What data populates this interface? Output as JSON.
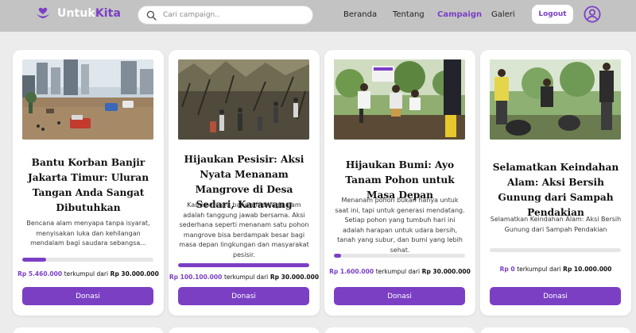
{
  "brand": {
    "name_part1": "Untuk",
    "name_part2": "Kita",
    "logo_icon": "heart-hands-icon",
    "accent": "#7b3fc4"
  },
  "search": {
    "placeholder": "Cari campaign..",
    "icon": "search-icon"
  },
  "nav": [
    {
      "label": "Beranda",
      "active": false
    },
    {
      "label": "Tentang",
      "active": false
    },
    {
      "label": "Campaign",
      "active": true
    },
    {
      "label": "Galeri",
      "active": false
    }
  ],
  "header": {
    "logout_label": "Logout",
    "avatar_icon": "user-circle-icon"
  },
  "campaigns": [
    {
      "title": "Bantu Korban Banjir Jakarta Timur: Uluran Tangan Anda Sangat Dibutuhkan",
      "description": "Bencana alam menyapa tanpa isyarat, menyisakan luka dan kehilangan mendalam bagi saudara sebangsa...",
      "collected": "Rp 5.460.000",
      "collected_label": "terkumpul dari",
      "target": "Rp 30.000.000",
      "progress": 0.182,
      "donate_label": "Donasi",
      "image": "flooded-city-street-photo"
    },
    {
      "title": "Hijaukan Pesisir: Aksi Nyata Menanam Mangrove di Desa Sedari, Karawang",
      "description": "Kami percaya bahwa menjaga alam adalah tanggung jawab bersama. Aksi sederhana seperti menanam satu pohon mangrove bisa berdampak besar bagi masa depan lingkungan dan masyarakat pesisir.",
      "collected": "Rp 100.100.000",
      "collected_label": "terkumpul dari",
      "target": "Rp 30.000.000",
      "progress": 1.0,
      "donate_label": "Donasi",
      "image": "mangrove-planting-photo"
    },
    {
      "title": "Hijaukan Bumi: Ayo Tanam Pohon untuk Masa Depan",
      "description": "Menanam pohon bukan hanya untuk saat ini, tapi untuk generasi mendatang. Setiap pohon yang tumbuh hari ini adalah harapan untuk udara bersih, tanah yang subur, dan bumi yang lebih sehat.",
      "collected": "Rp 1.600.000",
      "collected_label": "terkumpul dari",
      "target": "Rp 30.000.000",
      "progress": 0.053,
      "donate_label": "Donasi",
      "image": "tree-planting-volunteers-photo"
    },
    {
      "title": "Selamatkan Keindahan Alam: Aksi Bersih Gunung dari Sampah Pendakian",
      "description": "Selamatkan Keindahan Alam: Aksi Bersih Gunung dari Sampah Pendakian",
      "collected": "Rp 0",
      "collected_label": "terkumpul dari",
      "target": "Rp 10.000.000",
      "progress": 0.0,
      "donate_label": "Donasi",
      "image": "mountain-cleanup-photo"
    }
  ]
}
